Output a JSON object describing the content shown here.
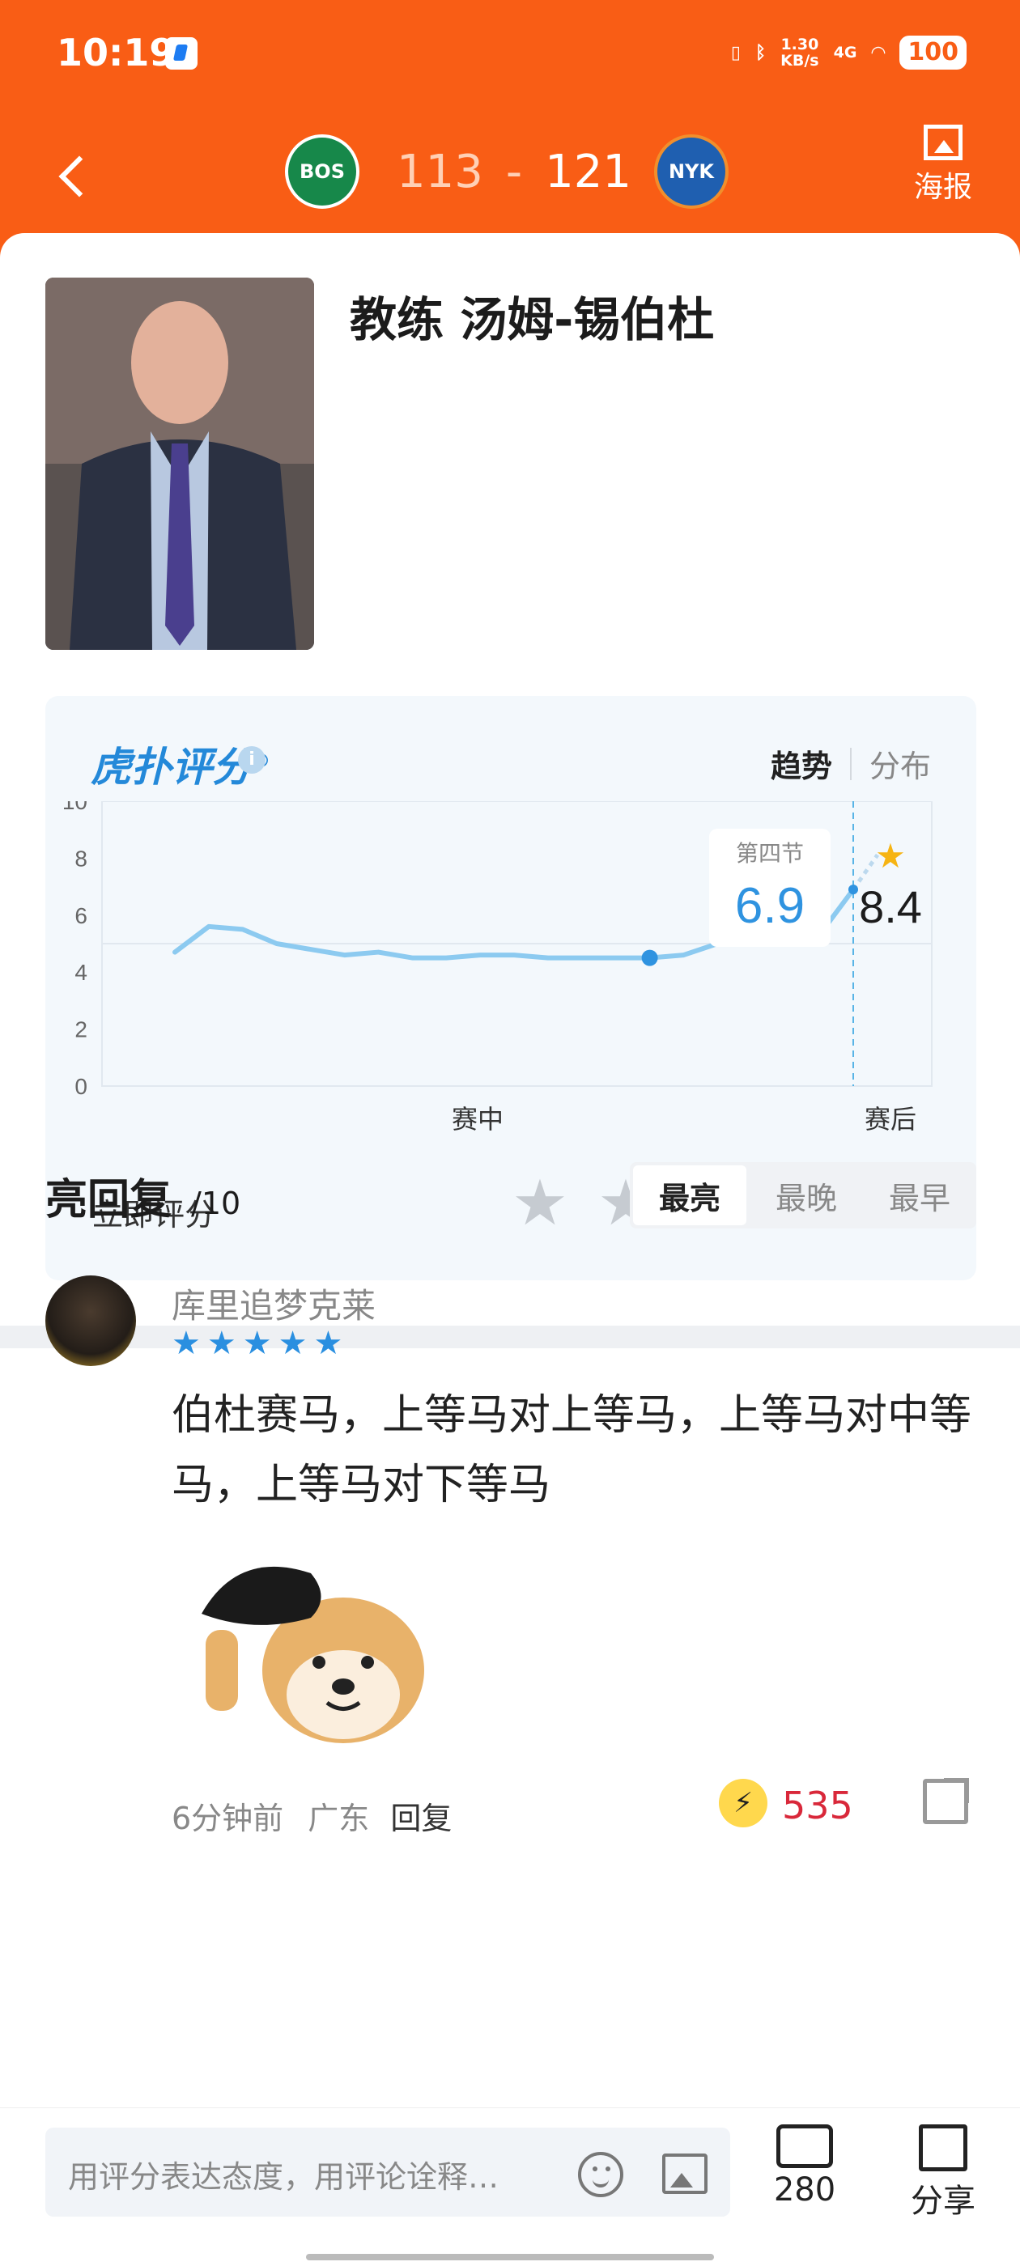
{
  "status_bar": {
    "time": "10:19",
    "net_speed": "1.30\nKB/s",
    "signal": "4G",
    "battery": "100"
  },
  "nav": {
    "score_home": "113",
    "score_dash": "-",
    "score_away": "121",
    "home_team": "BOS",
    "away_team": "NYK",
    "poster_label": "海报"
  },
  "coach": {
    "title": "教练 汤姆-锡伯杜"
  },
  "rating": {
    "brand": "虎扑评分",
    "trademark": "®",
    "tab_trend": "趋势",
    "tab_distribution": "分布",
    "rate_now_label": "立即评分",
    "tooltip_period": "第四节",
    "tooltip_value": "6.9",
    "final_value": "8.4"
  },
  "chart_data": {
    "type": "line",
    "ylim": [
      0,
      10
    ],
    "y_ticks": [
      "10",
      "8",
      "6",
      "4",
      "2",
      "0"
    ],
    "x_labels": [
      "赛中",
      "赛后"
    ],
    "series": [
      {
        "values": [
          4.7,
          5.6,
          5.5,
          5.0,
          4.8,
          4.6,
          4.7,
          4.5,
          4.5,
          4.6,
          4.6,
          4.5,
          4.5,
          4.5,
          4.5,
          4.6,
          5.0,
          5.0,
          5.0,
          5.3,
          6.9,
          8.4
        ]
      }
    ],
    "highlight_value": 4.5,
    "colors": {
      "line": "#8ccaf0",
      "point": "#2f93e0",
      "dashed": "#58b4e6",
      "star": "#f6b413"
    }
  },
  "replies": {
    "title": "亮回复",
    "count": "/10",
    "sort_tabs": [
      "最亮",
      "最晚",
      "最早"
    ],
    "items": [
      {
        "user": "库里追梦克莱",
        "stars": 5,
        "text": "伯杜赛马，上等马对上等马，上等马对中等马，上等马对下等马",
        "time": "6分钟前",
        "location": "广东",
        "reply_label": "回复",
        "lights": "535"
      }
    ]
  },
  "bottom_bar": {
    "input_placeholder": "用评分表达态度，用评论诠释…",
    "comment_count": "280",
    "share_label": "分享"
  }
}
